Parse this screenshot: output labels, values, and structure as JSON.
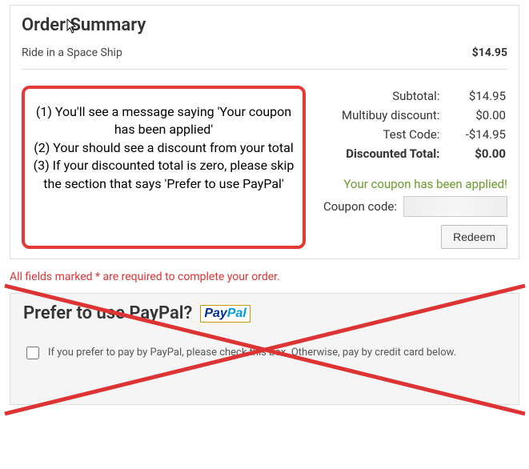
{
  "order": {
    "title": "Order Summary",
    "item": {
      "name": "Ride in a Space Ship",
      "price": "$14.95"
    },
    "summary": {
      "subtotal": {
        "label": "Subtotal:",
        "value": "$14.95"
      },
      "multibuy": {
        "label": "Multibuy discount:",
        "value": "$0.00"
      },
      "test_code": {
        "label": "Test Code:",
        "value": "-$14.95"
      },
      "discounted_total": {
        "label": "Discounted Total:",
        "value": "$0.00"
      }
    },
    "coupon": {
      "applied_msg": "Your coupon has been applied!",
      "label": "Coupon code:",
      "value": "",
      "redeem": "Redeem"
    }
  },
  "callout": {
    "line1": "(1) You'll see a message saying 'Your coupon has been applied'",
    "line2": "(2) Your should see a discount from your total",
    "line3": "(3) If your discounted total is zero, please skip the section that says 'Prefer to use PayPal'"
  },
  "required_note": "All fields marked * are required to complete your order.",
  "paypal": {
    "heading": "Prefer to use PayPal?",
    "checkbox_label": "If you prefer to pay by PayPal, please check this box. Otherwise, pay by credit card below."
  },
  "annotation": {
    "callout_border": "#e53935",
    "cross_out_color": "#d33"
  }
}
